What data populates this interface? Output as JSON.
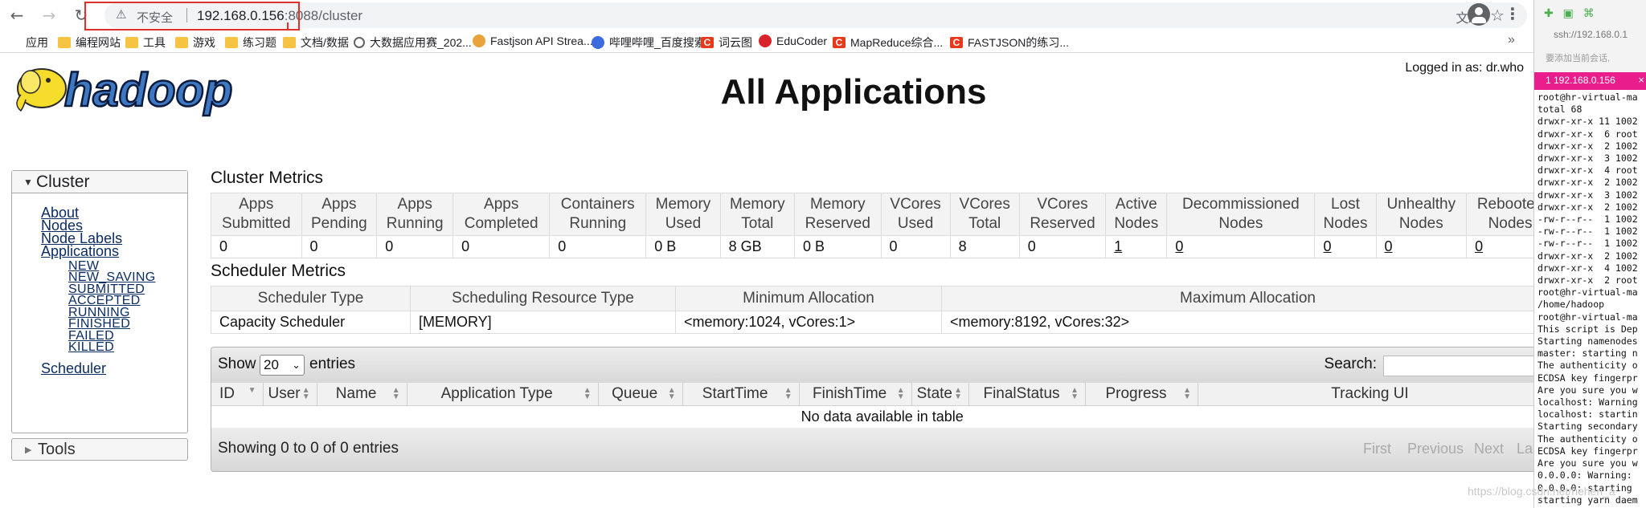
{
  "browser": {
    "security_label": "不安全",
    "url_host": "192.168.0.156",
    "url_rest": ":8088/cluster",
    "bookmarks": [
      {
        "label": "应用",
        "icon": "apps-grid-icon"
      },
      {
        "label": "编程网站",
        "icon": "folder-icon"
      },
      {
        "label": "工具",
        "icon": "folder-icon"
      },
      {
        "label": "游戏",
        "icon": "folder-icon"
      },
      {
        "label": "练习题",
        "icon": "folder-icon"
      },
      {
        "label": "文档/数据",
        "icon": "folder-icon"
      },
      {
        "label": "大数据应用赛_202...",
        "icon": "globe-icon"
      },
      {
        "label": "Fastjson API Strea...",
        "icon": "fastjson-icon"
      },
      {
        "label": "哔哩哔哩_百度搜索",
        "icon": "baidu-paw-icon"
      },
      {
        "label": "词云图",
        "icon": "csdn-icon"
      },
      {
        "label": "EduCoder",
        "icon": "educoder-icon"
      },
      {
        "label": "MapReduce综合...",
        "icon": "csdn-icon"
      },
      {
        "label": "FASTJSON的练习...",
        "icon": "csdn-icon"
      }
    ],
    "more_label": "»"
  },
  "page": {
    "logo_text": "hadoop",
    "title": "All Applications",
    "logged_in": "Logged in as: dr.who"
  },
  "nav": {
    "cluster_label": "Cluster",
    "items": [
      "About",
      "Nodes",
      "Node Labels",
      "Applications"
    ],
    "app_states": [
      "NEW",
      "NEW_SAVING",
      "SUBMITTED",
      "ACCEPTED",
      "RUNNING",
      "FINISHED",
      "FAILED",
      "KILLED"
    ],
    "scheduler": "Scheduler",
    "tools_label": "Tools"
  },
  "cluster_metrics": {
    "title": "Cluster Metrics",
    "headers": [
      [
        "Apps",
        "Submitted"
      ],
      [
        "Apps",
        "Pending"
      ],
      [
        "Apps",
        "Running"
      ],
      [
        "Apps",
        "Completed"
      ],
      [
        "Containers",
        "Running"
      ],
      [
        "Memory",
        "Used"
      ],
      [
        "Memory",
        "Total"
      ],
      [
        "Memory",
        "Reserved"
      ],
      [
        "VCores",
        "Used"
      ],
      [
        "VCores",
        "Total"
      ],
      [
        "VCores",
        "Reserved"
      ],
      [
        "Active",
        "Nodes"
      ],
      [
        "Decommissioned",
        "Nodes"
      ],
      [
        "Lost",
        "Nodes"
      ],
      [
        "Unhealthy",
        "Nodes"
      ],
      [
        "Rebooted",
        "Nodes"
      ]
    ],
    "values": [
      "0",
      "0",
      "0",
      "0",
      "0",
      "0 B",
      "8 GB",
      "0 B",
      "0",
      "8",
      "0",
      "1",
      "0",
      "0",
      "0",
      "0"
    ]
  },
  "scheduler_metrics": {
    "title": "Scheduler Metrics",
    "headers": [
      "Scheduler Type",
      "Scheduling Resource Type",
      "Minimum Allocation",
      "Maximum Allocation"
    ],
    "values": [
      "Capacity Scheduler",
      "[MEMORY]",
      "<memory:1024, vCores:1>",
      "<memory:8192, vCores:32>"
    ]
  },
  "apps_table": {
    "show_label": "Show",
    "entries_value": "20",
    "entries_label": "entries",
    "search_label": "Search:",
    "columns": [
      "ID",
      "User",
      "Name",
      "Application Type",
      "Queue",
      "StartTime",
      "FinishTime",
      "State",
      "FinalStatus",
      "Progress",
      "Tracking UI"
    ],
    "empty_message": "No data available in table",
    "info": "Showing 0 to 0 of 0 entries",
    "pagination": [
      "First",
      "Previous",
      "Next",
      "Last"
    ]
  },
  "terminal": {
    "address": "ssh://192.168.0.1",
    "warning": "要添加当前会话,",
    "tab_label": "1 192.168.0.156",
    "lines": [
      "root@hr-virtual-ma",
      "total 68",
      "drwxr-xr-x 11 1002",
      "drwxr-xr-x  6 root",
      "drwxr-xr-x  2 1002",
      "drwxr-xr-x  3 1002",
      "drwxr-xr-x  4 root",
      "drwxr-xr-x  2 1002",
      "drwxr-xr-x  3 1002",
      "drwxr-xr-x  2 1002",
      "-rw-r--r--  1 1002",
      "-rw-r--r--  1 1002",
      "-rw-r--r--  1 1002",
      "drwxr-xr-x  2 1002",
      "drwxr-xr-x  4 1002",
      "drwxr-xr-x  2 root",
      "root@hr-virtual-ma",
      "/home/hadoop",
      "root@hr-virtual-ma",
      "This script is Dep",
      "Starting namenodes",
      "master: starting n",
      "The authenticity o",
      "ECDSA key fingerpr",
      "Are you sure you w",
      "localhost: Warning",
      "localhost: startin",
      "Starting secondary",
      "The authenticity o",
      "ECDSA key fingerpr",
      "Are you sure you w",
      "0.0.0.0: Warning: ",
      "0.0.0.0: starting ",
      "starting yarn daem"
    ]
  },
  "watermark": "https://blog.csdn.net/hehen_a"
}
